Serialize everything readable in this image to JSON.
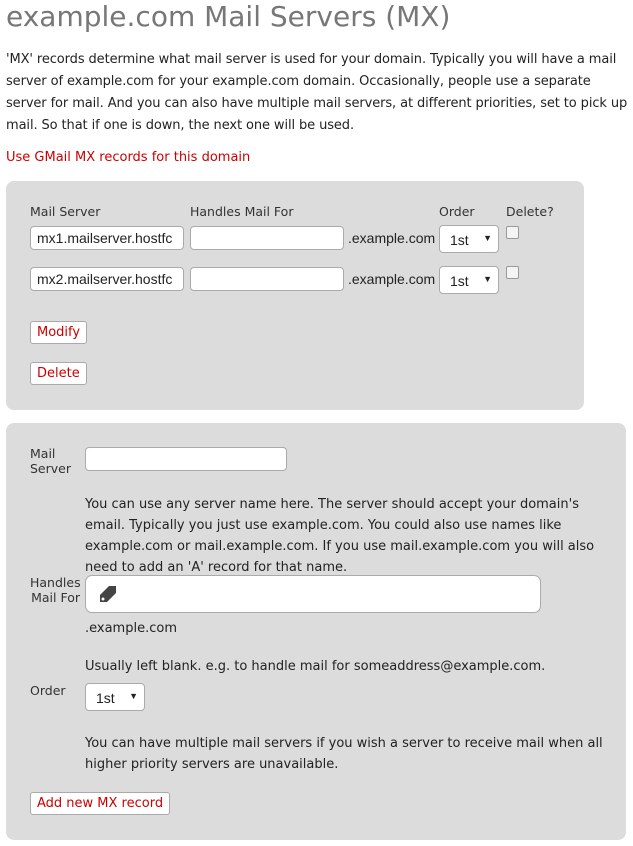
{
  "title": "example.com Mail Servers (MX)",
  "intro": "'MX' records determine what mail server is used for your domain.  Typically you will have a mail server of example.com for your example.com domain.  Occasionally, people use a separate server for mail.  And you can also have multiple mail servers, at different priorities, set to pick up mail.  So that if one is down, the next one will be used.",
  "gmail_link": "Use GMail MX records for this domain",
  "existing": {
    "headers": {
      "server": "Mail Server",
      "handles": "Handles Mail For",
      "order": "Order",
      "delete": "Delete?"
    },
    "rows": [
      {
        "server": "mx1.mailserver.hostfc",
        "handles": "",
        "suffix": ".example.com",
        "order": "1st",
        "delete": false
      },
      {
        "server": "mx2.mailserver.hostfc",
        "handles": "",
        "suffix": ".example.com",
        "order": "1st",
        "delete": false
      }
    ],
    "modify": "Modify",
    "delete_btn": "Delete"
  },
  "new": {
    "server_label": "Mail Server",
    "server_value": "",
    "server_help": "You can use any server name here.  The server should accept your domain's email.  Typically you just use example.com.  You could also use names like example.com or mail.example.com.  If you use mail.example.com you will also need to add an 'A' record for that name.",
    "handles_label": "Handles Mail For",
    "handles_value": "",
    "handles_icon": "tag-icon",
    "suffix": ".example.com",
    "handles_help": "Usually left blank.  e.g. to handle mail for someaddress@example.com.",
    "order_label": "Order",
    "order_value": "1st",
    "order_help": "You can have multiple mail servers if you wish a server to receive mail when all higher priority servers are unavailable.",
    "add": "Add new MX record"
  },
  "colors": {
    "accent": "#cc0000",
    "panel": "#dcdcdc"
  }
}
